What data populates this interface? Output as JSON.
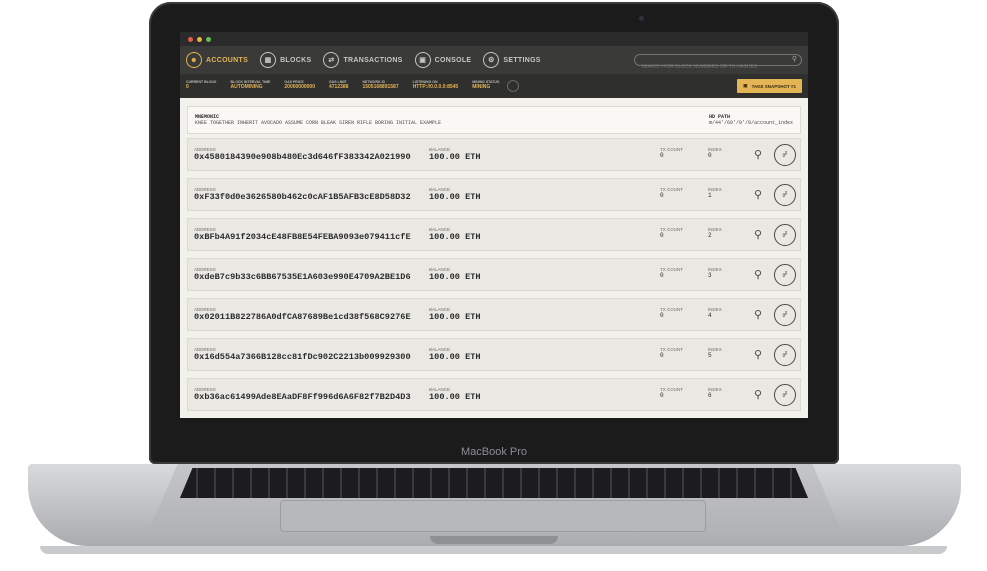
{
  "device": {
    "label": "MacBook Pro"
  },
  "window": {
    "dots": [
      "#e25c4f",
      "#e9b33f",
      "#5fc24b"
    ]
  },
  "nav": {
    "items": [
      {
        "label": "ACCOUNTS",
        "icon": "person-icon",
        "active": true
      },
      {
        "label": "BLOCKS",
        "icon": "blocks-icon"
      },
      {
        "label": "TRANSACTIONS",
        "icon": "transactions-icon"
      },
      {
        "label": "CONSOLE",
        "icon": "console-icon"
      },
      {
        "label": "SETTINGS",
        "icon": "gear-icon"
      }
    ],
    "search_placeholder": "SEARCH FOR BLOCK NUMBERS OR TX HASHES"
  },
  "status": [
    {
      "label": "CURRENT BLOCK",
      "value": "0"
    },
    {
      "label": "BLOCK INTERVAL TIME",
      "value": "AUTOMINING"
    },
    {
      "label": "GAS PRICE",
      "value": "20000000000"
    },
    {
      "label": "GAS LIMIT",
      "value": "4712388"
    },
    {
      "label": "NETWORK ID",
      "value": "1505168891587"
    },
    {
      "label": "LISTENING ON",
      "value": "HTTP://0.0.0.0:8545"
    },
    {
      "label": "MINING STATUS",
      "value": "MINING"
    }
  ],
  "snapshot_label": "TAKE SNAPSHOT #1",
  "mnemonic": {
    "label": "MNEMONIC",
    "value": "KNEE TOGETHER INHERIT AVOCADO ASSUME CORN BLEAK SIREN RIFLE BORING INITIAL EXAMPLE",
    "hd_label": "HD PATH",
    "hd_value": "m/44'/60'/0'/0/account_index"
  },
  "labels": {
    "address": "ADDRESS",
    "balance": "BALANCE",
    "tx_count": "TX COUNT",
    "index": "INDEX"
  },
  "accounts": [
    {
      "address": "0x4580184390e908b480Ec3d646fF383342A021990",
      "balance": "100.00 ETH",
      "tx_count": "0",
      "index": "0"
    },
    {
      "address": "0xF33f0d0e3626580b462c0cAF1B5AFB3cE8D58D32",
      "balance": "100.00 ETH",
      "tx_count": "0",
      "index": "1"
    },
    {
      "address": "0xBFb4A91f2034cE48FB8E54FEBA9093e079411cfE",
      "balance": "100.00 ETH",
      "tx_count": "0",
      "index": "2"
    },
    {
      "address": "0xdeB7c9b33c6BB67535E1A603e990E4709A2BE1D6",
      "balance": "100.00 ETH",
      "tx_count": "0",
      "index": "3"
    },
    {
      "address": "0x02011B822786A0dfCA87689Be1cd38f568C9276E",
      "balance": "100.00 ETH",
      "tx_count": "0",
      "index": "4"
    },
    {
      "address": "0x16d554a7366B128cc81fDc902C2213b009929300",
      "balance": "100.00 ETH",
      "tx_count": "0",
      "index": "5"
    },
    {
      "address": "0xb36ac61499Ade8EAaDF8Ff996d6A6F82f7B2D4D3",
      "balance": "100.00 ETH",
      "tx_count": "0",
      "index": "6"
    }
  ]
}
